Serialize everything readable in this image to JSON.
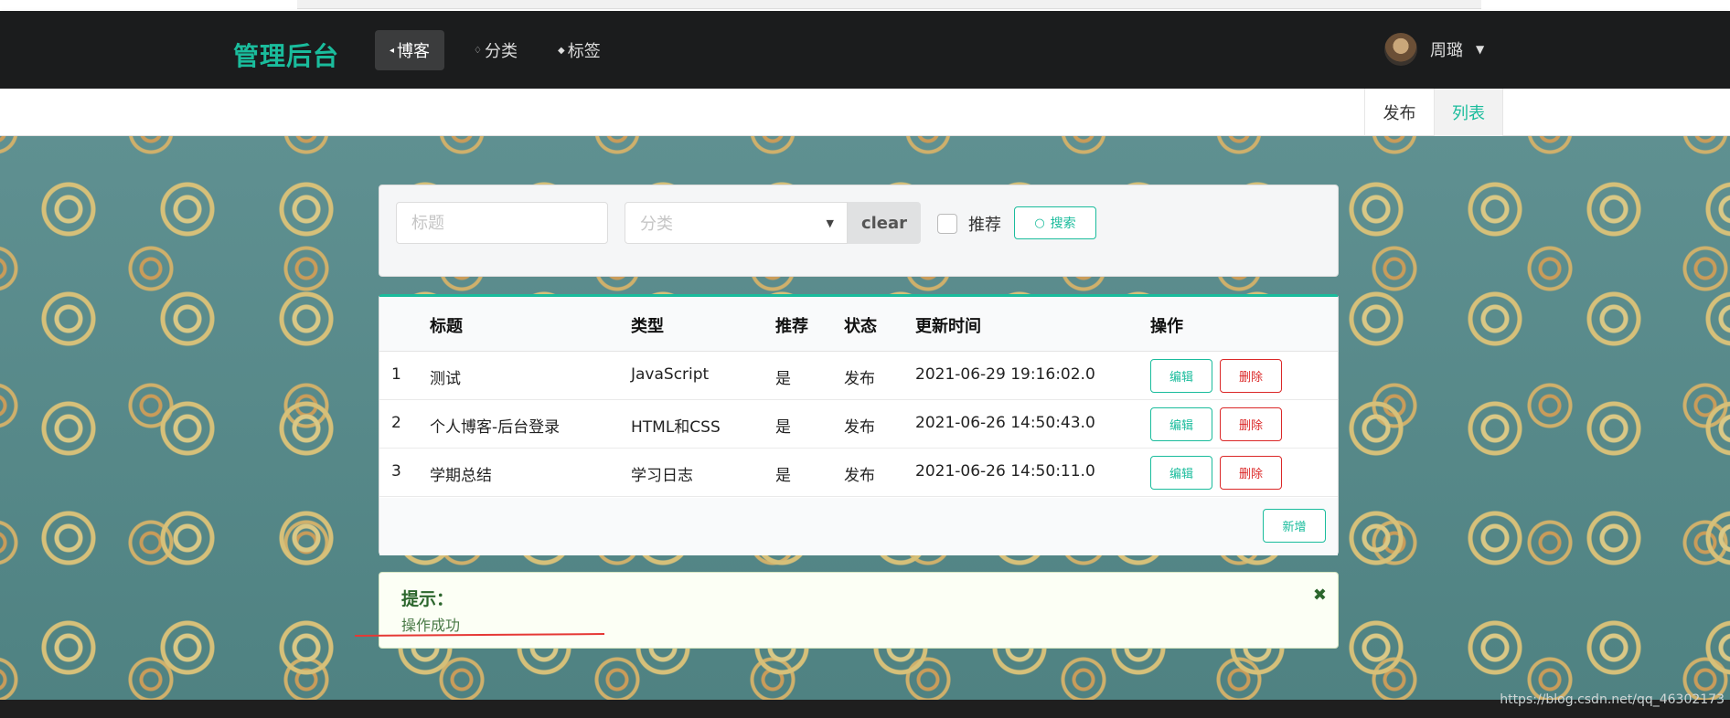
{
  "header": {
    "brand": "管理后台",
    "nav": [
      {
        "label": "博客",
        "icon": "home-icon"
      },
      {
        "label": "分类",
        "icon": "idea-icon"
      },
      {
        "label": "标签",
        "icon": "tags-icon"
      }
    ],
    "user": {
      "name": "周璐"
    }
  },
  "submenu": {
    "publish": "发布",
    "list": "列表"
  },
  "search": {
    "title_placeholder": "标题",
    "category_placeholder": "分类",
    "clear": "clear",
    "recommend_label": "推荐",
    "search_button": "搜索"
  },
  "table": {
    "headers": [
      "",
      "标题",
      "类型",
      "推荐",
      "状态",
      "更新时间",
      "操作"
    ],
    "rows": [
      {
        "no": "1",
        "title": "测试",
        "type": "JavaScript",
        "recommend": "是",
        "status": "发布",
        "updated": "2021-06-29 19:16:02.0"
      },
      {
        "no": "2",
        "title": "个人博客-后台登录",
        "type": "HTML和CSS",
        "recommend": "是",
        "status": "发布",
        "updated": "2021-06-26 14:50:43.0"
      },
      {
        "no": "3",
        "title": "学期总结",
        "type": "学习日志",
        "recommend": "是",
        "status": "发布",
        "updated": "2021-06-26 14:50:11.0"
      }
    ],
    "edit_label": "编辑",
    "delete_label": "删除",
    "add_label": "新增"
  },
  "message": {
    "title": "提示：",
    "text": "操作成功"
  },
  "watermark": "https://blog.csdn.net/qq_46302173",
  "colors": {
    "accent": "#1abc9c",
    "danger": "#db2828",
    "header_bg": "#1b1c1d",
    "message_text": "#2c662d"
  }
}
